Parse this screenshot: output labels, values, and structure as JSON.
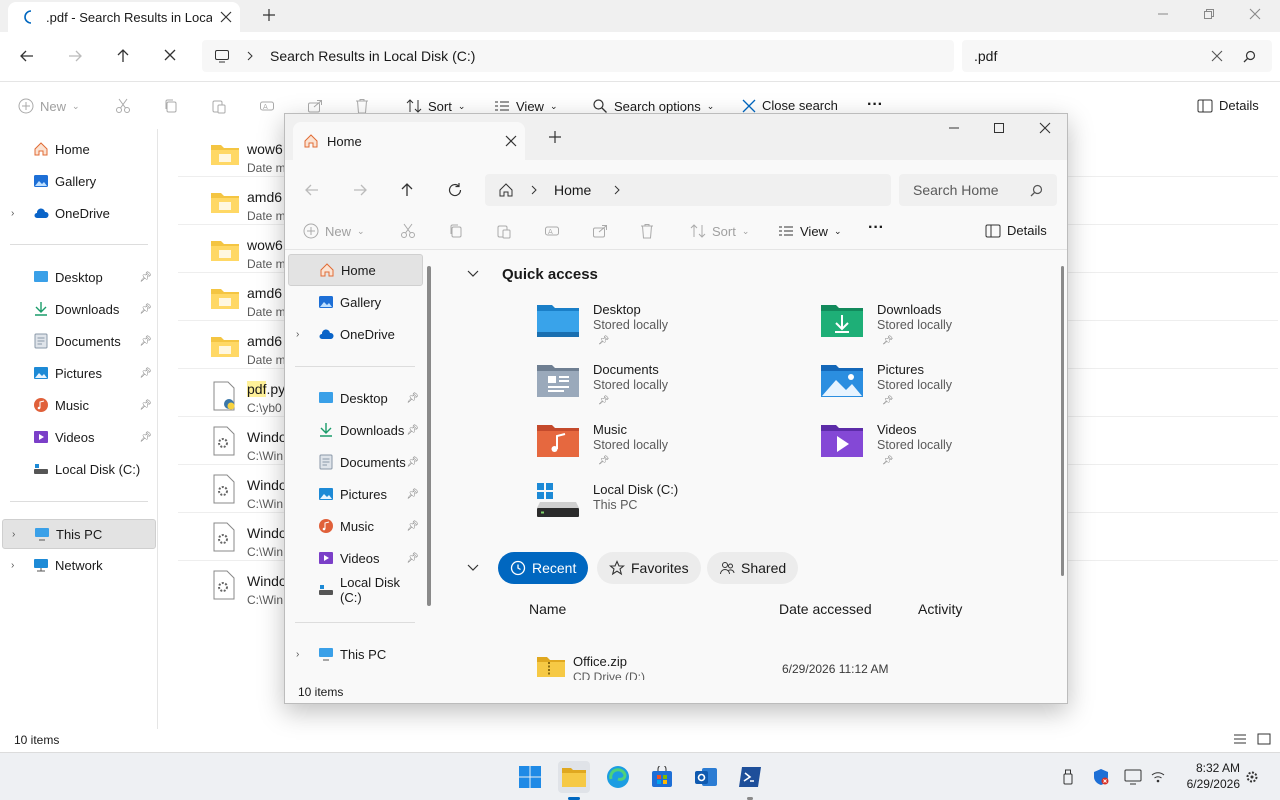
{
  "bg": {
    "tab_title": ".pdf - Search Results in Local D",
    "address": "Search Results in Local Disk (C:)",
    "search_value": ".pdf",
    "toolbar": {
      "new": "New",
      "sort": "Sort",
      "view": "View",
      "search_options": "Search options",
      "close_search": "Close search",
      "details": "Details"
    },
    "nav": {
      "home": "Home",
      "gallery": "Gallery",
      "onedrive": "OneDrive",
      "desktop": "Desktop",
      "downloads": "Downloads",
      "documents": "Documents",
      "pictures": "Pictures",
      "music": "Music",
      "videos": "Videos",
      "local_disk": "Local Disk (C:)",
      "this_pc": "This PC",
      "network": "Network"
    },
    "files": [
      {
        "name": "wow6",
        "sub": "Date m"
      },
      {
        "name": "amd6",
        "sub": "Date m"
      },
      {
        "name": "wow6",
        "sub": "Date m"
      },
      {
        "name": "amd6",
        "sub": "Date m"
      },
      {
        "name": "amd6",
        "sub": "Date m"
      },
      {
        "name_hl": "pdf",
        "name_rest": ".py",
        "sub": "C:\\yb0"
      },
      {
        "name": "Windo",
        "sub": "C:\\Win"
      },
      {
        "name": "Windo",
        "sub": "C:\\Win"
      },
      {
        "name": "Windo",
        "sub": "C:\\Win"
      },
      {
        "name": "Windo",
        "sub": "C:\\Win"
      }
    ],
    "status": "10 items"
  },
  "fg": {
    "tab_title": "Home",
    "breadcrumb": "Home",
    "search_placeholder": "Search Home",
    "toolbar": {
      "new": "New",
      "sort": "Sort",
      "view": "View",
      "details": "Details"
    },
    "nav": {
      "home": "Home",
      "gallery": "Gallery",
      "onedrive": "OneDrive",
      "desktop": "Desktop",
      "downloads": "Downloads",
      "documents": "Documents",
      "pictures": "Pictures",
      "music": "Music",
      "videos": "Videos",
      "local_disk": "Local Disk (C:)",
      "this_pc": "This PC"
    },
    "quick_access_title": "Quick access",
    "quick_access": [
      {
        "name": "Desktop",
        "sub": "Stored locally"
      },
      {
        "name": "Downloads",
        "sub": "Stored locally"
      },
      {
        "name": "Documents",
        "sub": "Stored locally"
      },
      {
        "name": "Pictures",
        "sub": "Stored locally"
      },
      {
        "name": "Music",
        "sub": "Stored locally"
      },
      {
        "name": "Videos",
        "sub": "Stored locally"
      },
      {
        "name": "Local Disk (C:)",
        "sub": "This PC"
      }
    ],
    "tabs": {
      "recent": "Recent",
      "favorites": "Favorites",
      "shared": "Shared"
    },
    "columns": {
      "name": "Name",
      "date": "Date accessed",
      "activity": "Activity"
    },
    "recent_files": [
      {
        "name": "Office.zip",
        "location": "CD Drive (D:)",
        "date": "6/29/2026 11:12 AM"
      }
    ],
    "status": "10 items"
  },
  "taskbar": {
    "time": "8:32 AM",
    "date": "6/29/2026"
  },
  "colors": {
    "accent": "#0067c0",
    "folder": "#f4c542",
    "selected": "#e3e3e3"
  }
}
